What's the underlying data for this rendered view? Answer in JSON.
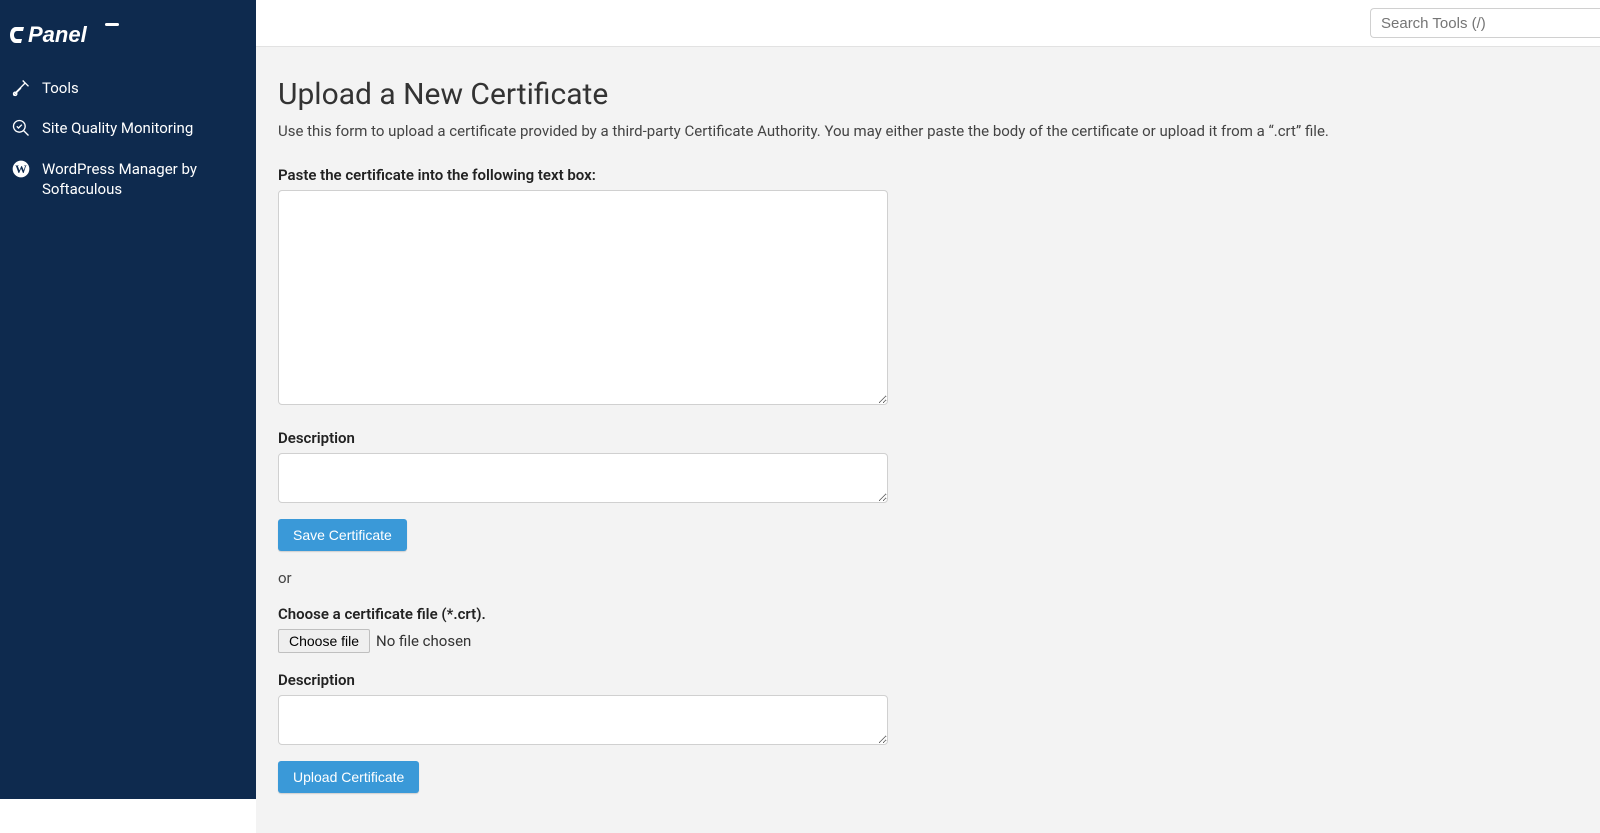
{
  "brand": "cPanel",
  "search": {
    "placeholder": "Search Tools (/)"
  },
  "sidebar": {
    "items": [
      {
        "label": "Tools",
        "icon": "tools-icon"
      },
      {
        "label": "Site Quality Monitoring",
        "icon": "magnify-check-icon"
      },
      {
        "label": "WordPress Manager by Softaculous",
        "icon": "wordpress-icon"
      }
    ]
  },
  "page": {
    "title": "Upload a New Certificate",
    "intro": "Use this form to upload a certificate provided by a third-party Certificate Authority. You may either paste the body of the certificate or upload it from a “.crt” file.",
    "paste_label": "Paste the certificate into the following text box:",
    "description_label": "Description",
    "save_button": "Save Certificate",
    "or_text": "or",
    "choose_cert_label": "Choose a certificate file (*.crt).",
    "choose_file_button": "Choose file",
    "no_file_text": "No file chosen",
    "description_label_2": "Description",
    "upload_button": "Upload Certificate"
  }
}
